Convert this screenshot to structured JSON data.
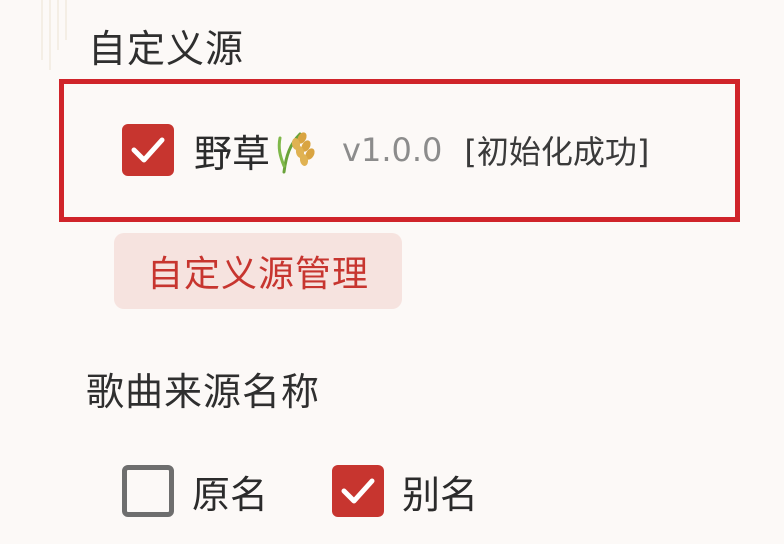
{
  "custom_source": {
    "title": "自定义源",
    "source": {
      "name": "野草",
      "emoji_icon": "wheat-icon",
      "version": "v1.0.0",
      "status": "[初始化成功]",
      "checked": true
    },
    "manage_button": "自定义源管理"
  },
  "song_source_name": {
    "title": "歌曲来源名称",
    "options": [
      {
        "label": "原名",
        "checked": false
      },
      {
        "label": "别名",
        "checked": true
      }
    ]
  },
  "colors": {
    "accent": "#c7352f",
    "highlight_border": "#d0242a",
    "button_bg": "#f6e3df",
    "background": "#fcf9f7"
  }
}
